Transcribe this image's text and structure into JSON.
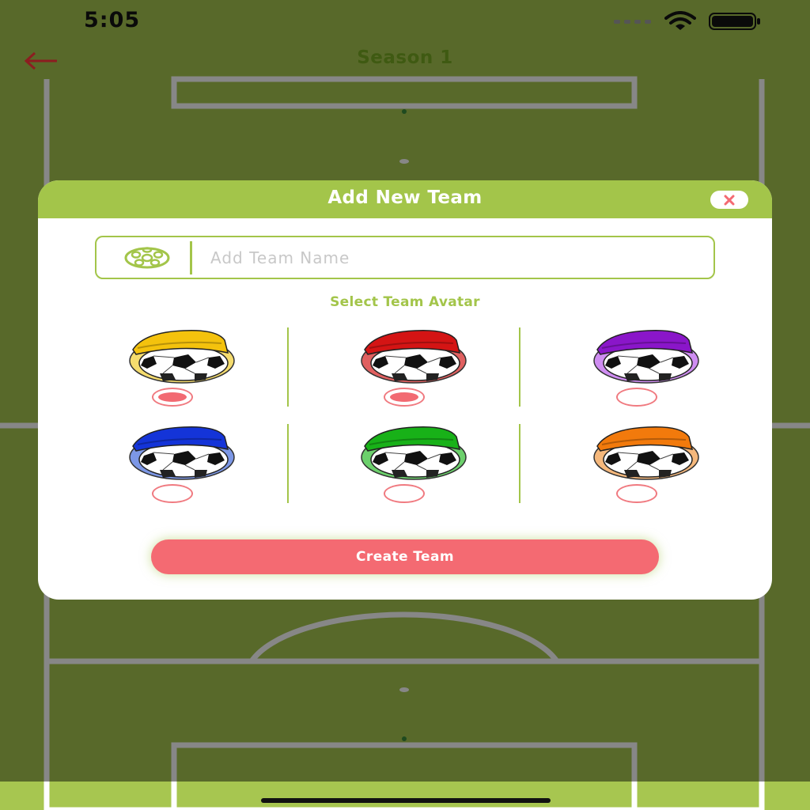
{
  "status_bar": {
    "time": "5:05",
    "signal_icon": "signal-dots-icon",
    "wifi_icon": "wifi-icon",
    "battery_icon": "battery-icon"
  },
  "nav": {
    "title": "Season 1",
    "back_icon": "back-arrow-icon"
  },
  "modal": {
    "title": "Add New Team",
    "close_icon": "close-icon",
    "team_name": {
      "value": "",
      "placeholder": "Add Team Name",
      "icon": "soccer-ball-icon"
    },
    "select_label": "Select Team Avatar",
    "avatars": [
      {
        "color": "yellow",
        "cap_hex": "#f4c20d",
        "ring_hex": "#f5dc6e",
        "selected": true
      },
      {
        "color": "red",
        "cap_hex": "#d41414",
        "ring_hex": "#e06060",
        "selected": true
      },
      {
        "color": "purple",
        "cap_hex": "#8a16c9",
        "ring_hex": "#cf8df2",
        "selected": false
      },
      {
        "color": "blue",
        "cap_hex": "#1434d8",
        "ring_hex": "#7c97e6",
        "selected": false
      },
      {
        "color": "green",
        "cap_hex": "#18b118",
        "ring_hex": "#6cd06c",
        "selected": false
      },
      {
        "color": "orange",
        "cap_hex": "#f27a0c",
        "ring_hex": "#f5b87c",
        "selected": false
      }
    ],
    "create_button": "Create Team"
  },
  "colors": {
    "accent_green": "#a3c54a",
    "accent_red": "#f46a72",
    "field_green": "#a7c650",
    "nav_title": "#3f5a12"
  }
}
